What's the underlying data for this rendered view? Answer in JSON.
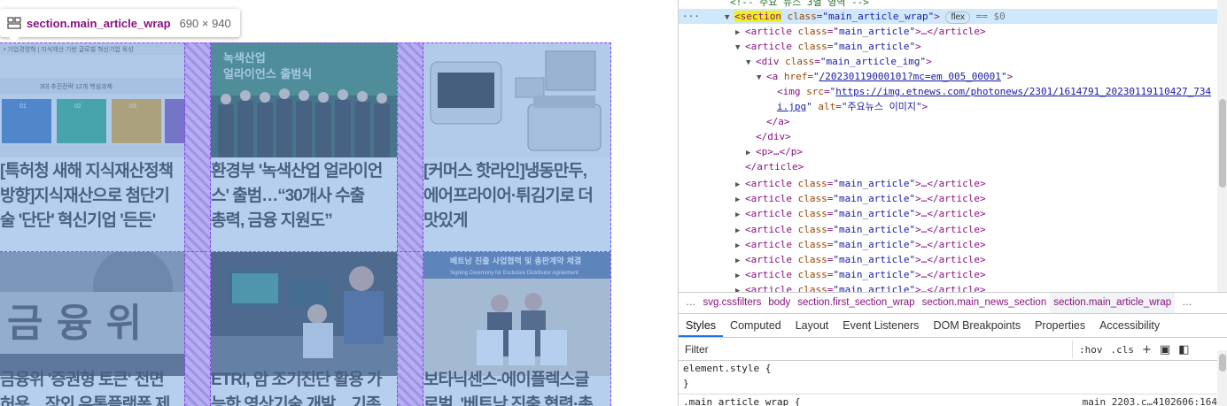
{
  "tooltip": {
    "selector": "section.main_article_wrap",
    "dimensions": "690 × 940"
  },
  "articles": [
    {
      "image": "기업경영혁 | 지식재산 기반 글로벌 혁신기업 육성 · 3대 추진전략 12개 핵심과제 · 01 지식재산 행정시스템 혁신 · 02 첨단산업 분야 미래쟁쟁력 확보 · 03 혁신기업의 시장 경쟁활성 조성",
      "lines": [
        "[특허청 새해 지식재산정책",
        "방향]지식재산으로 첨단기",
        "술 '단단' 혁신기업 '든든'"
      ]
    },
    {
      "image": "녹색산업 얼라이언스 출범식",
      "lines": [
        "환경부 '녹색산업 얼라이언",
        "스' 출범…“30개사 수출",
        "총력, 금융 지원도”"
      ]
    },
    {
      "image": "에어프라이어 제품 이미지",
      "lines": [
        "[커머스 핫라인]냉동만두,",
        "에어프라이어·튀김기로 더",
        "맛있게"
      ]
    },
    {
      "image": "금융위원회",
      "lines": [
        "금융위 '증권형 토큰' 전면",
        "허용…장외 유통플랫폼 제"
      ]
    },
    {
      "image": "연구실 이미지",
      "lines": [
        "ETRI, 암 조기진단 활용 가",
        "능한 영상기술 개발…기존"
      ]
    },
    {
      "image": "베트남 진출 사업협력 및 총판계약 체결 · Signing Ceremony for Exclusive Distributor Agreement",
      "lines": [
        "보타닉센스-에이플렉스글",
        "로벌, '베트남 진출 협력·총"
      ]
    }
  ],
  "devtools": {
    "dom": {
      "comment_top": "<!-- 주요 뉴스 3열 영역 -->",
      "lines": [
        {
          "tag": "section",
          "cls": "main_article_wrap",
          "badge": "flex",
          "suffix": "== $0"
        },
        {
          "tag": "article",
          "cls": "main_article",
          "collapsed": true
        },
        {
          "tag": "article",
          "cls": "main_article",
          "open": true
        },
        {
          "tag": "div",
          "cls": "main_article_img"
        },
        {
          "href": "/20230119000101?mc=em_005_00001"
        },
        {
          "src_part1": "https://img.etnews.com/photonews/2301/1614791_20230119110427_734",
          "src_part2": "i.jpg",
          "alt": "주요뉴스 이미지"
        },
        {
          "close": "</a>"
        },
        {
          "close": "</div>"
        },
        {
          "p": "<p>…</p>"
        },
        {
          "close": "</article>"
        },
        {
          "tag": "article",
          "cls": "main_article",
          "collapsed": true
        },
        {
          "tag": "article",
          "cls": "main_article",
          "collapsed": true
        },
        {
          "tag": "article",
          "cls": "main_article",
          "collapsed": true
        },
        {
          "tag": "article",
          "cls": "main_article",
          "collapsed": true
        },
        {
          "tag": "article",
          "cls": "main_article",
          "collapsed": true
        },
        {
          "tag": "article",
          "cls": "main_article",
          "collapsed": true
        },
        {
          "tag": "article",
          "cls": "main_article",
          "collapsed": true
        },
        {
          "tag": "article",
          "cls": "main_article",
          "collapsed": true
        }
      ],
      "dots": "···"
    },
    "breadcrumbs": [
      "…",
      "svg.cssfilters",
      "body",
      "section.first_section_wrap",
      "section.main_news_section",
      "section.main_article_wrap",
      "…"
    ],
    "tabs": [
      "Styles",
      "Computed",
      "Layout",
      "Event Listeners",
      "DOM Breakpoints",
      "Properties",
      "Accessibility"
    ],
    "filter": {
      "placeholder": "Filter",
      "hov": ":hov",
      "cls": ".cls",
      "plus": "+"
    },
    "styles": {
      "rule1_selector": "element.style {",
      "rule1_close": "}",
      "rule2_selector": ".main_article_wrap {",
      "rule2_source": "main_2203.c…4102606:164"
    }
  }
}
